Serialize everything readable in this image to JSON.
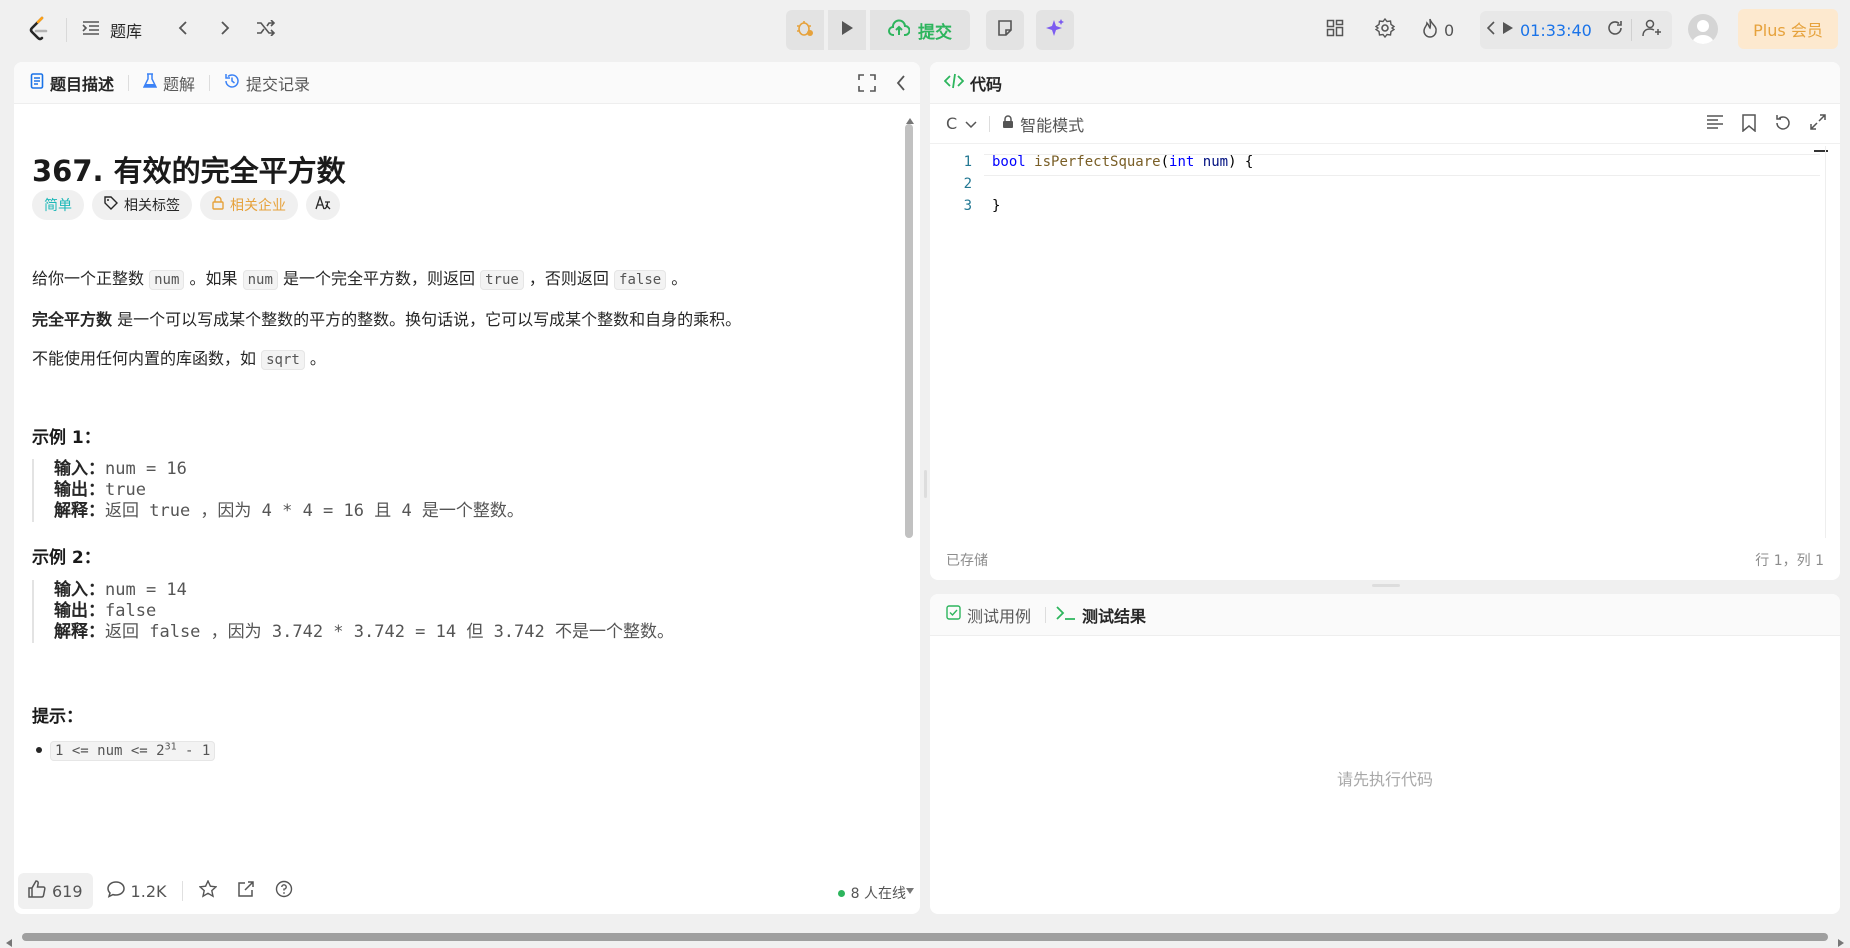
{
  "topbar": {
    "problem_list_label": "题库",
    "submit_label": "提交",
    "streak_count": "0",
    "timer": "01:33:40",
    "plus_label": "Plus 会员"
  },
  "left": {
    "tabs": [
      {
        "label": "题目描述"
      },
      {
        "label": "题解"
      },
      {
        "label": "提交记录"
      }
    ],
    "title": "367. 有效的完全平方数",
    "chips": {
      "difficulty": "简单",
      "tags": "相关标签",
      "companies": "相关企业"
    },
    "p1": {
      "a": "给你一个正整数",
      "c1": "num",
      "b": "。如果",
      "c2": "num",
      "c": "是一个完全平方数，则返回",
      "c3": "true",
      "d": "，否则返回",
      "c4": "false",
      "e": "。"
    },
    "p2": {
      "bold": "完全平方数",
      "rest": "是一个可以写成某个整数的平方的整数。换句话说，它可以写成某个整数和自身的乘积。"
    },
    "p3": {
      "a": "不能使用任何内置的库函数，如",
      "c1": "sqrt",
      "b": "。"
    },
    "example1": {
      "heading": "示例 1：",
      "input_label": "输入：",
      "input": "num = 16",
      "output_label": "输出：",
      "output": "true",
      "explain_label": "解释：",
      "explain": "返回 true ，因为 4 * 4 = 16 且 4 是一个整数。"
    },
    "example2": {
      "heading": "示例 2：",
      "input_label": "输入：",
      "input": "num = 14",
      "output_label": "输出：",
      "output": "false",
      "explain_label": "解释：",
      "explain": "返回 false ，因为 3.742 * 3.742 = 14 但 3.742 不是一个整数。"
    },
    "hints_heading": "提示：",
    "constraint": {
      "a": "1 <= num <= 2",
      "sup": "31",
      "b": " - 1"
    },
    "bottom": {
      "likes": "619",
      "comments": "1.2K",
      "online": "8 人在线"
    }
  },
  "editor": {
    "tab_label": "代码",
    "language": "C",
    "mode": "智能模式",
    "line_numbers": [
      "1",
      "2",
      "3"
    ],
    "status_saved": "已存储",
    "status_pos": "行 1，列 1"
  },
  "results": {
    "tab_testcase": "测试用例",
    "tab_result": "测试结果",
    "empty_message": "请先执行代码"
  }
}
